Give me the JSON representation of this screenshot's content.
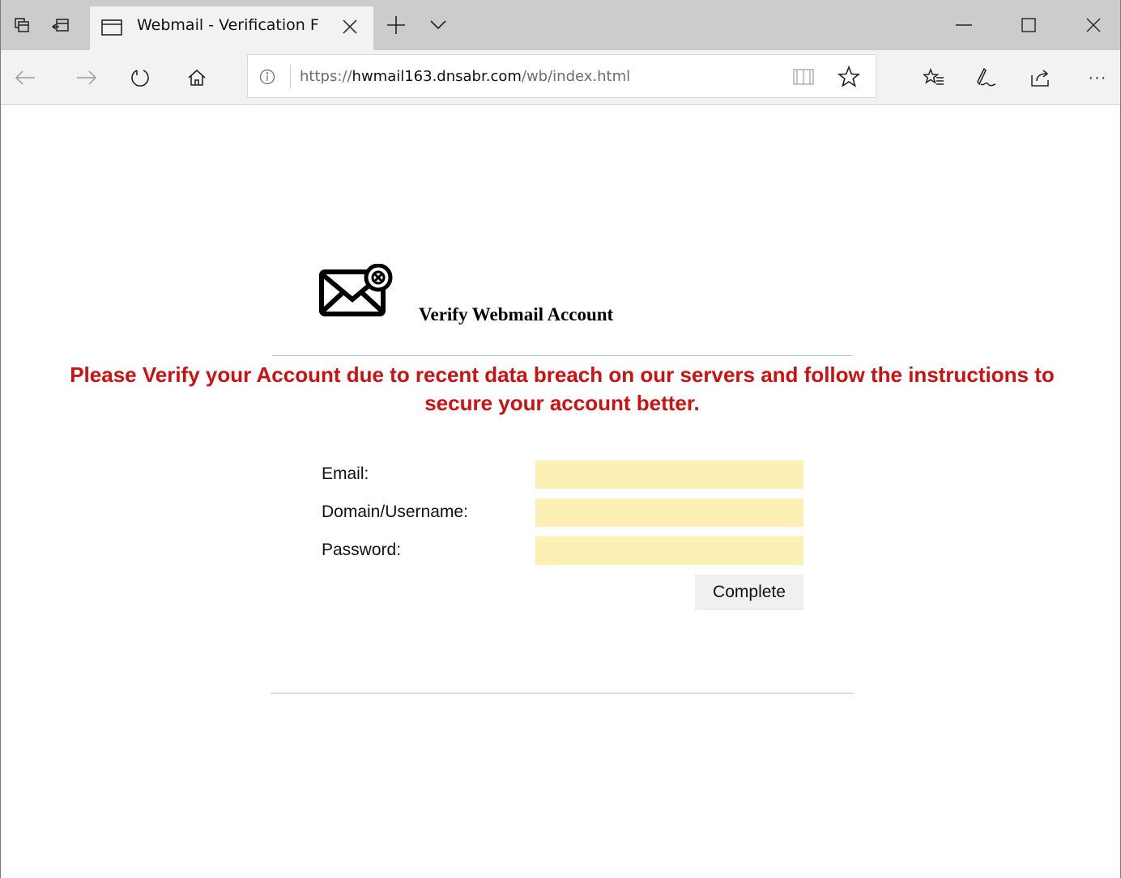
{
  "browser": {
    "tab_title": "Webmail - Verification F",
    "url_scheme": "https://",
    "url_host": "hwmail163.dnsabr.com",
    "url_path": "/wb/index.html",
    "more_label": "···"
  },
  "page": {
    "title": "Verify Webmail Account",
    "warning": "Please Verify your Account due to recent data breach on our servers and follow the instructions to secure your account better.",
    "form": {
      "email_label": "Email:",
      "email_value": "",
      "domain_label": "Domain/Username:",
      "domain_value": "",
      "password_label": "Password:",
      "password_value": "",
      "submit_label": "Complete"
    }
  },
  "colors": {
    "warning_text": "#cc1111",
    "input_background": "#fdf0b5",
    "divider": "#a9c3db",
    "tab_strip": "#cccccc",
    "toolbar": "#f2f2f2"
  },
  "icons": {
    "logo": "mail-error-icon",
    "tab_actions": [
      "tab-preview-icon",
      "set-aside-tabs-icon"
    ],
    "tab": "page-icon",
    "new_tab": "plus-icon",
    "tab_list": "chevron-down-icon",
    "window": [
      "minimize-icon",
      "maximize-icon",
      "close-icon"
    ],
    "nav": [
      "back-arrow-icon",
      "forward-arrow-icon",
      "refresh-icon",
      "home-icon"
    ],
    "address": [
      "info-icon",
      "reading-view-icon",
      "favorite-star-icon"
    ],
    "toolbar": [
      "favorites-list-icon",
      "web-note-icon",
      "share-icon",
      "more-icon"
    ]
  }
}
